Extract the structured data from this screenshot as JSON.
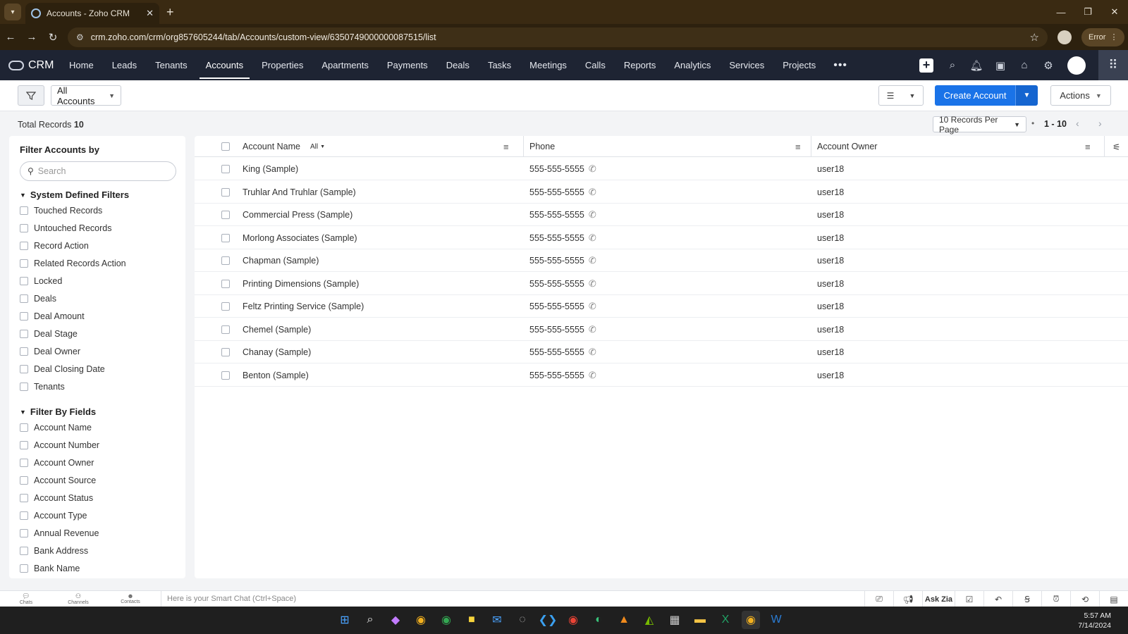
{
  "browser": {
    "tab_title": "Accounts - Zoho CRM",
    "url": "crm.zoho.com/crm/org857605244/tab/Accounts/custom-view/6350749000000087515/list",
    "error_label": "Error"
  },
  "nav": {
    "brand": "CRM",
    "items": [
      "Home",
      "Leads",
      "Tenants",
      "Accounts",
      "Properties",
      "Apartments",
      "Payments",
      "Deals",
      "Tasks",
      "Meetings",
      "Calls",
      "Reports",
      "Analytics",
      "Services",
      "Projects"
    ],
    "active": "Accounts",
    "more": "•••"
  },
  "toolbar": {
    "view_name": "All Accounts",
    "create_label": "Create Account",
    "actions_label": "Actions"
  },
  "records": {
    "total_label": "Total Records",
    "total_count": "10",
    "per_page": "10 Records Per Page",
    "range": "1 - 10"
  },
  "sidebar": {
    "title": "Filter Accounts by",
    "search_placeholder": "Search",
    "system_group": "System Defined Filters",
    "system_filters": [
      "Touched Records",
      "Untouched Records",
      "Record Action",
      "Related Records Action",
      "Locked",
      "Deals",
      "Deal Amount",
      "Deal Stage",
      "Deal Owner",
      "Deal Closing Date",
      "Tenants"
    ],
    "field_group": "Filter By Fields",
    "field_filters": [
      "Account Name",
      "Account Number",
      "Account Owner",
      "Account Source",
      "Account Status",
      "Account Type",
      "Annual Revenue",
      "Bank Address",
      "Bank Name"
    ]
  },
  "table": {
    "columns": {
      "name": "Account Name",
      "name_filter": "All",
      "phone": "Phone",
      "owner": "Account Owner"
    },
    "rows": [
      {
        "name": "King (Sample)",
        "phone": "555-555-5555",
        "owner": "user18"
      },
      {
        "name": "Truhlar And Truhlar (Sample)",
        "phone": "555-555-5555",
        "owner": "user18"
      },
      {
        "name": "Commercial Press (Sample)",
        "phone": "555-555-5555",
        "owner": "user18"
      },
      {
        "name": "Morlong Associates (Sample)",
        "phone": "555-555-5555",
        "owner": "user18"
      },
      {
        "name": "Chapman (Sample)",
        "phone": "555-555-5555",
        "owner": "user18"
      },
      {
        "name": "Printing Dimensions (Sample)",
        "phone": "555-555-5555",
        "owner": "user18"
      },
      {
        "name": "Feltz Printing Service (Sample)",
        "phone": "555-555-5555",
        "owner": "user18"
      },
      {
        "name": "Chemel (Sample)",
        "phone": "555-555-5555",
        "owner": "user18"
      },
      {
        "name": "Chanay (Sample)",
        "phone": "555-555-5555",
        "owner": "user18"
      },
      {
        "name": "Benton (Sample)",
        "phone": "555-555-5555",
        "owner": "user18"
      }
    ]
  },
  "bottombar": {
    "tabs": [
      "Chats",
      "Channels",
      "Contacts"
    ],
    "smart_chat_placeholder": "Here is your Smart Chat (Ctrl+Space)",
    "ask_zia": "Ask Zia"
  },
  "taskbar": {
    "time": "5:57 AM",
    "date": "7/14/2024"
  },
  "colors": {
    "nav_bg": "#1e2433",
    "primary": "#1a73e8",
    "browser_bg": "#2d210e"
  }
}
